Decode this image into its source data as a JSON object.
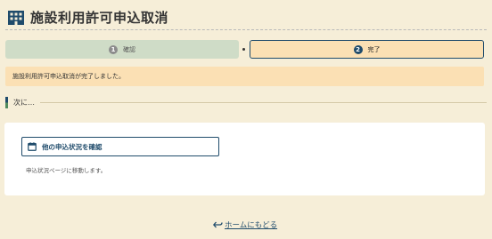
{
  "header": {
    "title": "施設利用許可申込取消",
    "icon": "building-icon"
  },
  "steps": [
    {
      "number": "1",
      "label": "確認",
      "state": "done"
    },
    {
      "number": "2",
      "label": "完了",
      "state": "current"
    }
  ],
  "notice": {
    "message": "施設利用許可申込取消が完了しました。"
  },
  "next_section": {
    "heading": "次に…"
  },
  "card": {
    "button_label": "他の申込状況を確認",
    "button_icon": "calendar-icon",
    "description": "申込状況ページに移動します。"
  },
  "footer": {
    "home_link_label": "ホームにもどる",
    "home_link_icon": "return-arrow-icon"
  },
  "colors": {
    "background": "#f6eed8",
    "primary": "#1f4b6b",
    "step_done": "#cfdcc7",
    "step_current": "#fbe0b4",
    "notice": "#fbe0b4",
    "card": "#ffffff"
  }
}
